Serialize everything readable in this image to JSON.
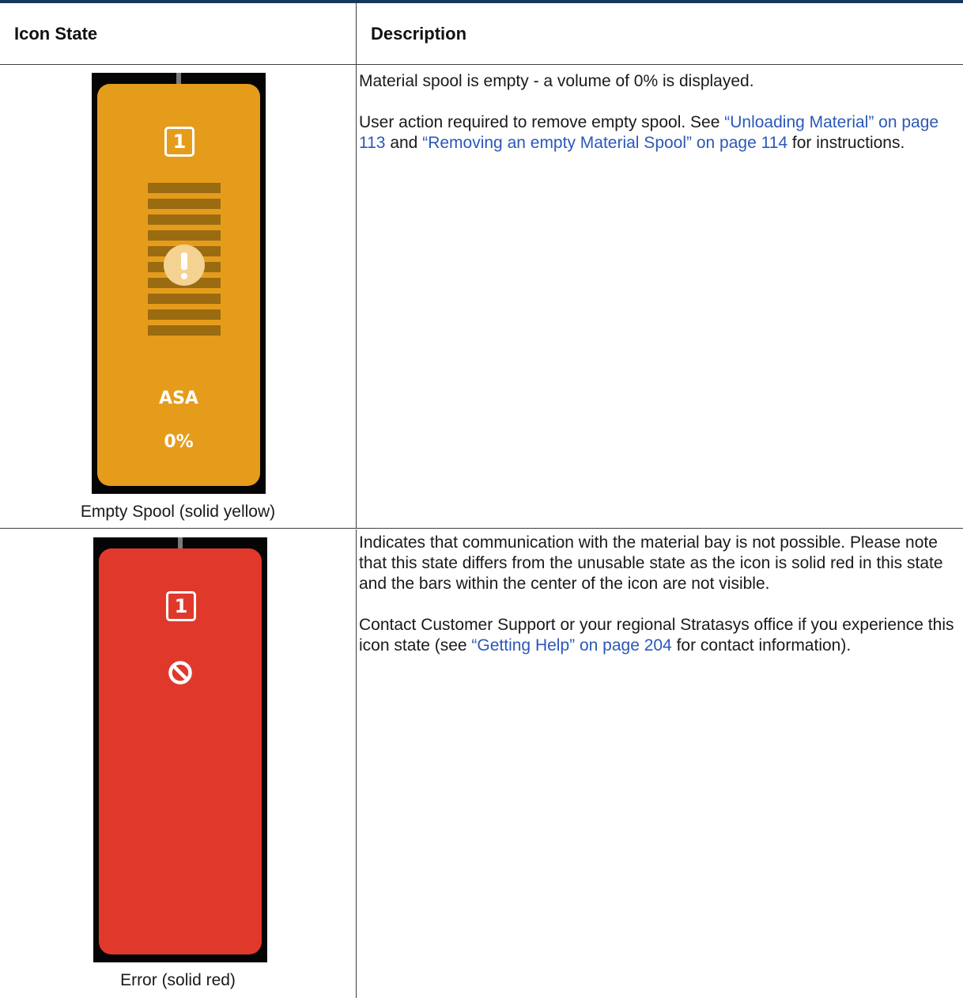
{
  "table": {
    "headers": {
      "icon_state": "Icon State",
      "description": "Description"
    },
    "rows": [
      {
        "icon": {
          "color": "#e69c1b",
          "slot_number": "1",
          "material": "ASA",
          "volume_percent": "0%",
          "status_icon": "exclamation-icon",
          "bar_count": 10
        },
        "caption": "Empty Spool (solid yellow)",
        "paragraph1": "Material spool is empty - a volume of 0% is displayed.",
        "paragraph2": {
          "text_a": "User action required to remove empty spool. See ",
          "link_a": "“Unloading Material” on page 113",
          "text_b": " and ",
          "link_b": "“Removing an empty Material Spool” on page 114",
          "text_c": " for instructions."
        }
      },
      {
        "icon": {
          "color": "#e0392c",
          "slot_number": "1",
          "status_icon": "prohibited-icon"
        },
        "caption": "Error (solid red)",
        "paragraph1": "Indicates that communication with the material bay is not possible. Please note that this state differs from the unusable state as the icon is solid red in this state and the bars within the center of the icon are not visible.",
        "paragraph2": {
          "text_a": "Contact Customer Support or your regional Stratasys office if you experience this icon state (see ",
          "link_a": "“Getting Help” on page 204",
          "text_b": " for contact information)."
        }
      }
    ]
  }
}
